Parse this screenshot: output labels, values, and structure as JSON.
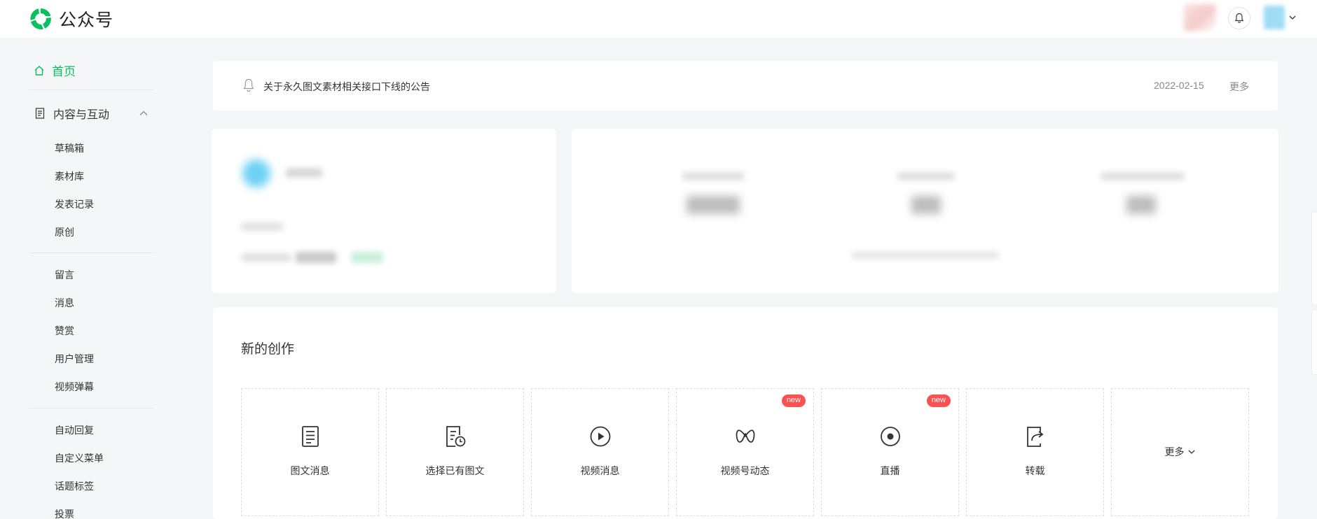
{
  "app": {
    "title": "公众号",
    "brand_color": "#07c160"
  },
  "header": {
    "icons": [
      "wechat-logo-icon",
      "bell-icon",
      "chevron-down-icon"
    ]
  },
  "sidebar": {
    "home": "首页",
    "group": "内容与互动",
    "section1": [
      "草稿箱",
      "素材库",
      "发表记录",
      "原创"
    ],
    "section2": [
      "留言",
      "消息",
      "赞赏",
      "用户管理",
      "视频弹幕"
    ],
    "section3": [
      "自动回复",
      "自定义菜单",
      "话题标签",
      "投票"
    ]
  },
  "notice": {
    "title": "关于永久图文素材相关接口下线的公告",
    "date": "2022-02-15",
    "more": "更多"
  },
  "create": {
    "title": "新的创作",
    "tiles": [
      {
        "label": "图文消息",
        "icon": "article-icon"
      },
      {
        "label": "选择已有图文",
        "icon": "history-article-icon"
      },
      {
        "label": "视频消息",
        "icon": "play-icon"
      },
      {
        "label": "视频号动态",
        "icon": "channels-icon",
        "badge": "new"
      },
      {
        "label": "直播",
        "icon": "live-icon",
        "badge": "new"
      },
      {
        "label": "转载",
        "icon": "repost-icon"
      }
    ],
    "more": "更多",
    "badge_color": "#fa5151"
  }
}
